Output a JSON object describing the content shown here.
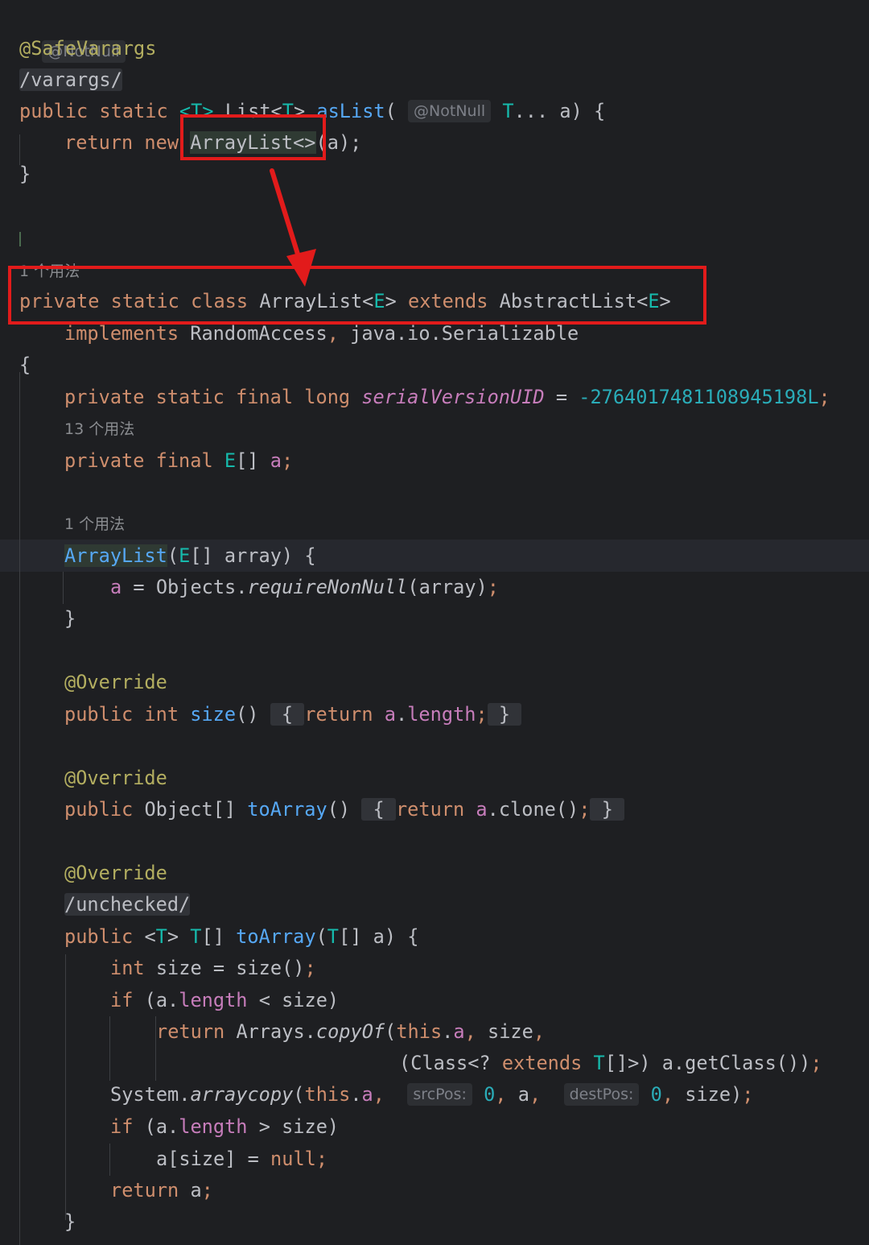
{
  "colors": {
    "keyword": "#cf8e6d",
    "annotation": "#b3ae60",
    "method": "#56a8f5",
    "type_param": "#16baac",
    "field": "#c77dbb",
    "number": "#2aacb8",
    "highlight_box": "#e21b1b"
  },
  "icons": {
    "arrow": "red-arrow-icon"
  },
  "hints": {
    "notnull_top": "@NotNull",
    "notnull_param": "@NotNull",
    "srcpos": "srcPos:",
    "destpos": "destPos:"
  },
  "usages": {
    "u1": "1 个用法",
    "u13": "13 个用法",
    "u1b": "1 个用法"
  },
  "code": {
    "safevarargs": "@SafeVarargs",
    "varargs": "/varargs/",
    "unchecked": "/unchecked/",
    "override": "@Override",
    "serial_value": "-2764017481108945198L",
    "serial_name": "serialVersionUID",
    "tail": ";"
  }
}
